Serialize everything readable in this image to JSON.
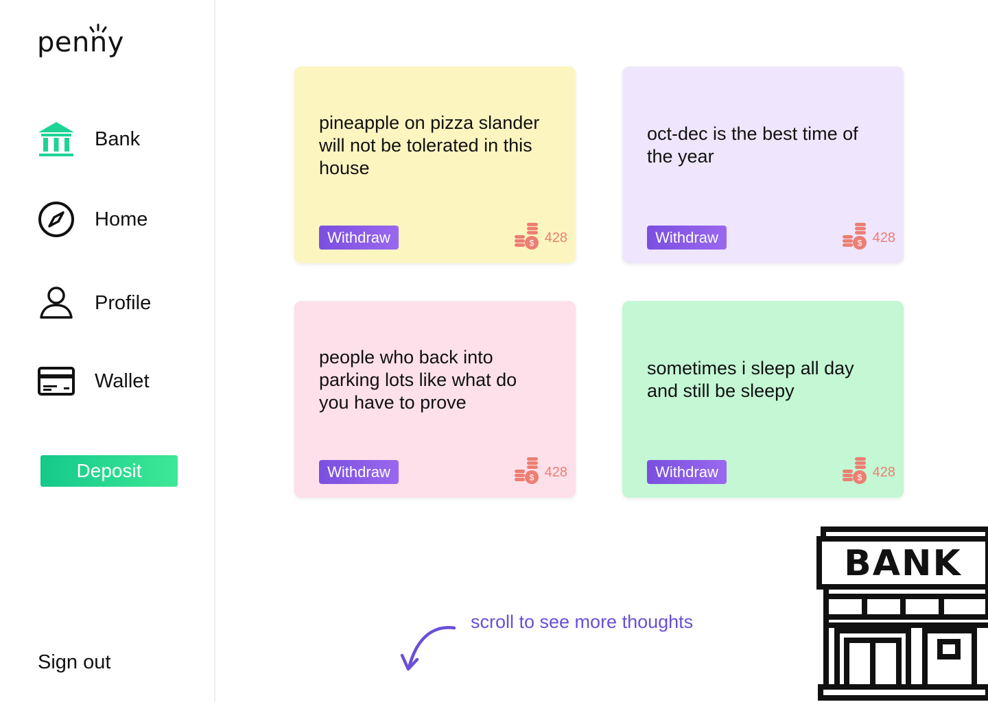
{
  "app": {
    "logo_text": "penny"
  },
  "sidebar": {
    "items": [
      {
        "label": "Bank",
        "icon": "bank-icon"
      },
      {
        "label": "Home",
        "icon": "compass-icon"
      },
      {
        "label": "Profile",
        "icon": "user-icon"
      },
      {
        "label": "Wallet",
        "icon": "credit-card-icon"
      }
    ],
    "deposit_label": "Deposit",
    "signout_label": "Sign out"
  },
  "cards": [
    {
      "text": "pineapple on pizza slander will not be tolerated in this house",
      "withdraw_label": "Withdraw",
      "coins": "428",
      "color": "#fdf5c0"
    },
    {
      "text": "oct-dec is the best time of the year",
      "withdraw_label": "Withdraw",
      "coins": "428",
      "color": "#efe6fd"
    },
    {
      "text": "people who back into parking lots like what do you have to prove",
      "withdraw_label": "Withdraw",
      "coins": "428",
      "color": "#fde0ea"
    },
    {
      "text": "sometimes i sleep all day and still be sleepy",
      "withdraw_label": "Withdraw",
      "coins": "428",
      "color": "#c4f7d4"
    }
  ],
  "hint": {
    "text": "scroll to see more thoughts",
    "icon": "curved-arrow-icon"
  },
  "illustration": {
    "sign_text": "BANK",
    "icon": "bank-building-icon"
  },
  "colors": {
    "accent_green": "#1ed394",
    "accent_purple": "#7c52e2",
    "coin_color": "#ec7e74",
    "hint_color": "#6b4fd6"
  }
}
